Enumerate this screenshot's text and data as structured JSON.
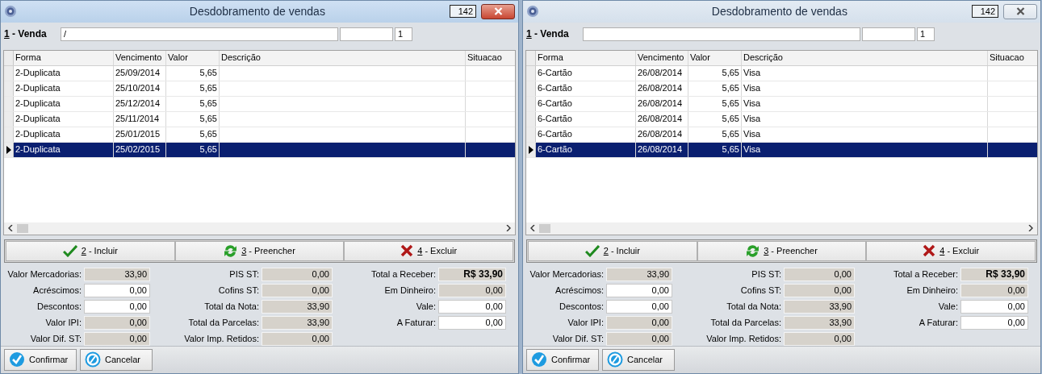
{
  "windows": [
    {
      "title": "Desdobramento de vendas",
      "active": true,
      "counter": "142",
      "sale": {
        "key": "1",
        "label": " - Venda",
        "code": "/",
        "number": "1"
      },
      "table": {
        "columns": [
          "Forma",
          "Vencimento",
          "Valor",
          "Descrição",
          "Situacao"
        ],
        "rows": [
          {
            "cells": [
              "2-Duplicata",
              "25/09/2014",
              "5,65"
            ],
            "selected": false
          },
          {
            "cells": [
              "2-Duplicata",
              "25/10/2014",
              "5,65"
            ],
            "selected": false
          },
          {
            "cells": [
              "2-Duplicata",
              "25/12/2014",
              "5,65"
            ],
            "selected": false
          },
          {
            "cells": [
              "2-Duplicata",
              "25/11/2014",
              "5,65"
            ],
            "selected": false
          },
          {
            "cells": [
              "2-Duplicata",
              "25/01/2015",
              "5,65"
            ],
            "selected": false
          },
          {
            "cells": [
              "2-Duplicata",
              "25/02/2015",
              "5,65"
            ],
            "selected": true
          }
        ]
      },
      "actions": [
        {
          "kind": "add",
          "key": "2",
          "label": " - Incluir"
        },
        {
          "kind": "fill",
          "key": "3",
          "label": " - Preencher"
        },
        {
          "kind": "delete",
          "key": "4",
          "label": " - Excluir"
        }
      ],
      "summary": [
        [
          {
            "label": "Valor Mercadorias:",
            "value": "33,90",
            "editable": false,
            "kind": "amount"
          },
          {
            "label": "Acréscimos:",
            "value": "0,00",
            "editable": true,
            "kind": "amount"
          },
          {
            "label": "Descontos:",
            "value": "0,00",
            "editable": true,
            "kind": "amount"
          },
          {
            "label": "Valor IPI:",
            "value": "0,00",
            "editable": false,
            "kind": "amount"
          },
          {
            "label": "Valor Dif. ST:",
            "value": "0,00",
            "editable": false,
            "kind": "amount"
          }
        ],
        [
          {
            "label": "PIS ST:",
            "value": "0,00",
            "editable": false,
            "kind": "amount"
          },
          {
            "label": "Cofins ST:",
            "value": "0,00",
            "editable": false,
            "kind": "amount"
          },
          {
            "label": "Total da Nota:",
            "value": "33,90",
            "editable": false,
            "kind": "amount"
          },
          {
            "label": "Total da Parcelas:",
            "value": "33,90",
            "editable": false,
            "kind": "amount"
          },
          {
            "label": "Valor Imp. Retidos:",
            "value": "0,00",
            "editable": false,
            "kind": "amount"
          }
        ],
        [
          {
            "label": "Total a Receber:",
            "value": "R$ 33,90",
            "editable": false,
            "kind": "total"
          },
          {
            "label": "Em Dinheiro:",
            "value": "0,00",
            "editable": false,
            "kind": "amount"
          },
          {
            "label": "Vale:",
            "value": "0,00",
            "editable": true,
            "kind": "amount"
          },
          {
            "label": "A Faturar:",
            "value": "0,00",
            "editable": true,
            "kind": "amount"
          }
        ]
      ],
      "buttons": [
        {
          "kind": "confirm",
          "label": "Confirmar"
        },
        {
          "kind": "cancel",
          "label": "Cancelar"
        }
      ]
    },
    {
      "title": "Desdobramento de vendas",
      "active": false,
      "counter": "142",
      "sale": {
        "key": "1",
        "label": " - Venda",
        "number": "1"
      },
      "table": {
        "columns": [
          "Forma",
          "Vencimento",
          "Valor",
          "Descrição",
          "Situacao"
        ],
        "rows": [
          {
            "cells": [
              "6-Cartão",
              "26/08/2014",
              "5,65",
              "Visa"
            ],
            "selected": false
          },
          {
            "cells": [
              "6-Cartão",
              "26/08/2014",
              "5,65",
              "Visa"
            ],
            "selected": false
          },
          {
            "cells": [
              "6-Cartão",
              "26/08/2014",
              "5,65",
              "Visa"
            ],
            "selected": false
          },
          {
            "cells": [
              "6-Cartão",
              "26/08/2014",
              "5,65",
              "Visa"
            ],
            "selected": false
          },
          {
            "cells": [
              "6-Cartão",
              "26/08/2014",
              "5,65",
              "Visa"
            ],
            "selected": false
          },
          {
            "cells": [
              "6-Cartão",
              "26/08/2014",
              "5,65",
              "Visa"
            ],
            "selected": true
          }
        ]
      },
      "actions": [
        {
          "kind": "add",
          "key": "2",
          "label": " - Incluir"
        },
        {
          "kind": "fill",
          "key": "3",
          "label": " - Preencher"
        },
        {
          "kind": "delete",
          "key": "4",
          "label": " - Excluir"
        }
      ],
      "summary": [
        [
          {
            "label": "Valor Mercadorias:",
            "value": "33,90",
            "editable": false,
            "kind": "amount"
          },
          {
            "label": "Acréscimos:",
            "value": "0,00",
            "editable": true,
            "kind": "amount"
          },
          {
            "label": "Descontos:",
            "value": "0,00",
            "editable": true,
            "kind": "amount"
          },
          {
            "label": "Valor IPI:",
            "value": "0,00",
            "editable": false,
            "kind": "amount"
          },
          {
            "label": "Valor Dif. ST:",
            "value": "0,00",
            "editable": false,
            "kind": "amount"
          }
        ],
        [
          {
            "label": "PIS ST:",
            "value": "0,00",
            "editable": false,
            "kind": "amount"
          },
          {
            "label": "Cofins ST:",
            "value": "0,00",
            "editable": false,
            "kind": "amount"
          },
          {
            "label": "Total da Nota:",
            "value": "33,90",
            "editable": false,
            "kind": "amount"
          },
          {
            "label": "Total da Parcelas:",
            "value": "33,90",
            "editable": false,
            "kind": "amount"
          },
          {
            "label": "Valor Imp. Retidos:",
            "value": "0,00",
            "editable": false,
            "kind": "amount"
          }
        ],
        [
          {
            "label": "Total a Receber:",
            "value": "R$ 33,90",
            "editable": false,
            "kind": "total"
          },
          {
            "label": "Em Dinheiro:",
            "value": "0,00",
            "editable": false,
            "kind": "amount"
          },
          {
            "label": "Vale:",
            "value": "0,00",
            "editable": true,
            "kind": "amount"
          },
          {
            "label": "A Faturar:",
            "value": "0,00",
            "editable": true,
            "kind": "amount"
          }
        ]
      ],
      "buttons": [
        {
          "kind": "confirm",
          "label": "Confirmar"
        },
        {
          "kind": "cancel",
          "label": "Cancelar"
        }
      ]
    }
  ]
}
